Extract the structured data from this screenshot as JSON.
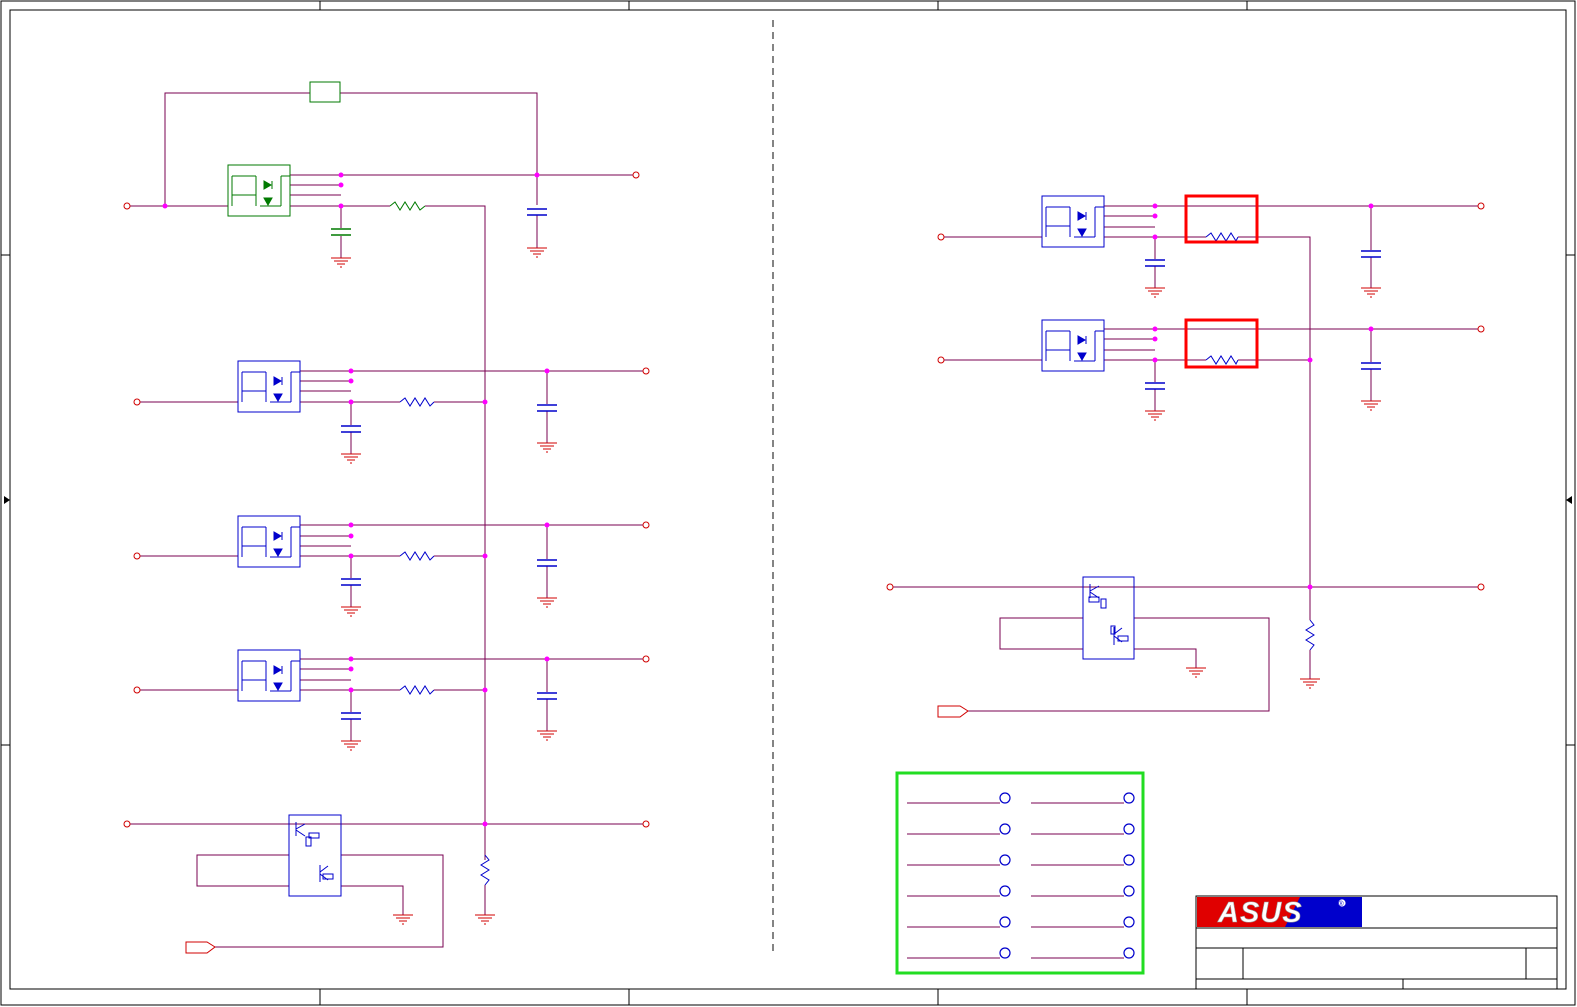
{
  "title_block": {
    "logo": "ASUS",
    "registered_mark": "®"
  },
  "colors": {
    "wire": "#7a0050",
    "border": "#000000",
    "junction": "#ff00ff",
    "ground": "#d00000",
    "mosfet_blue": "#0000cc",
    "mosfet_green": "#007a00",
    "highlight_red": "#ff0000",
    "highlight_green": "#22dd22",
    "logo_red": "#e00000",
    "logo_blue": "#0000cc"
  }
}
